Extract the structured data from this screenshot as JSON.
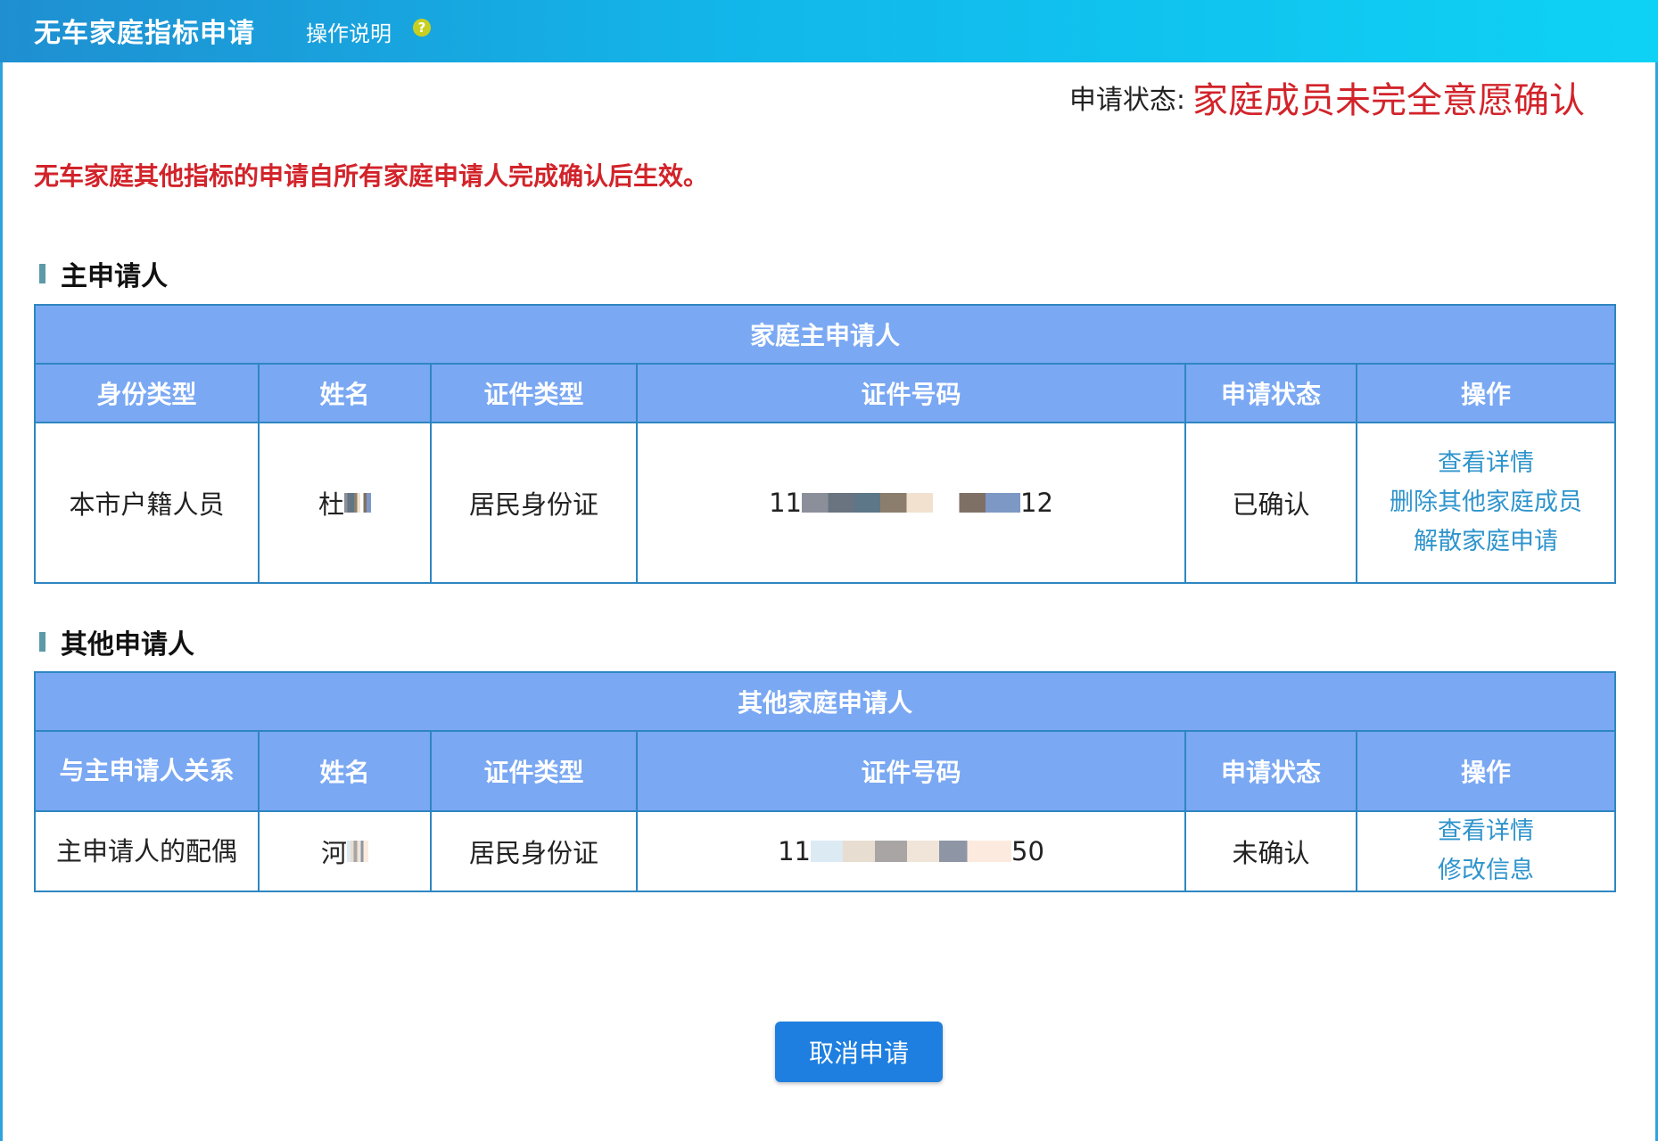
{
  "header": {
    "title": "无车家庭指标申请",
    "help_label": "操作说明",
    "help_icon": "question-circle-icon"
  },
  "status": {
    "label": "申请状态:",
    "value": "家庭成员未完全意愿确认"
  },
  "notice": "无车家庭其他指标的申请自所有家庭申请人完成确认后生效。",
  "main_section": {
    "heading": "主申请人",
    "table_caption": "家庭主申请人",
    "columns": [
      "身份类型",
      "姓名",
      "证件类型",
      "证件号码",
      "申请状态",
      "操作"
    ],
    "row": {
      "identity_type": "本市户籍人员",
      "name_visible": "杜",
      "id_type": "居民身份证",
      "id_prefix": "11",
      "id_suffix": "12",
      "status": "已确认",
      "actions": [
        "查看详情",
        "删除其他家庭成员",
        "解散家庭申请"
      ]
    }
  },
  "other_section": {
    "heading": "其他申请人",
    "table_caption": "其他家庭申请人",
    "columns": [
      "与主申请人关系",
      "姓名",
      "证件类型",
      "证件号码",
      "申请状态",
      "操作"
    ],
    "row": {
      "relation": "主申请人的配偶",
      "name_visible": "河",
      "id_type": "居民身份证",
      "id_prefix": "11",
      "id_suffix": "50",
      "status": "未确认",
      "actions": [
        "查看详情",
        "修改信息"
      ]
    }
  },
  "cancel_button": "取消申请",
  "colors": {
    "header_gradient_start": "#1f8fd1",
    "header_gradient_end": "#0ed2f5",
    "table_header": "#7aa8f3",
    "table_border": "#2e86c1",
    "alert_red": "#d2232a",
    "link_blue": "#2f94cc",
    "button_blue": "#1e7fe0"
  }
}
